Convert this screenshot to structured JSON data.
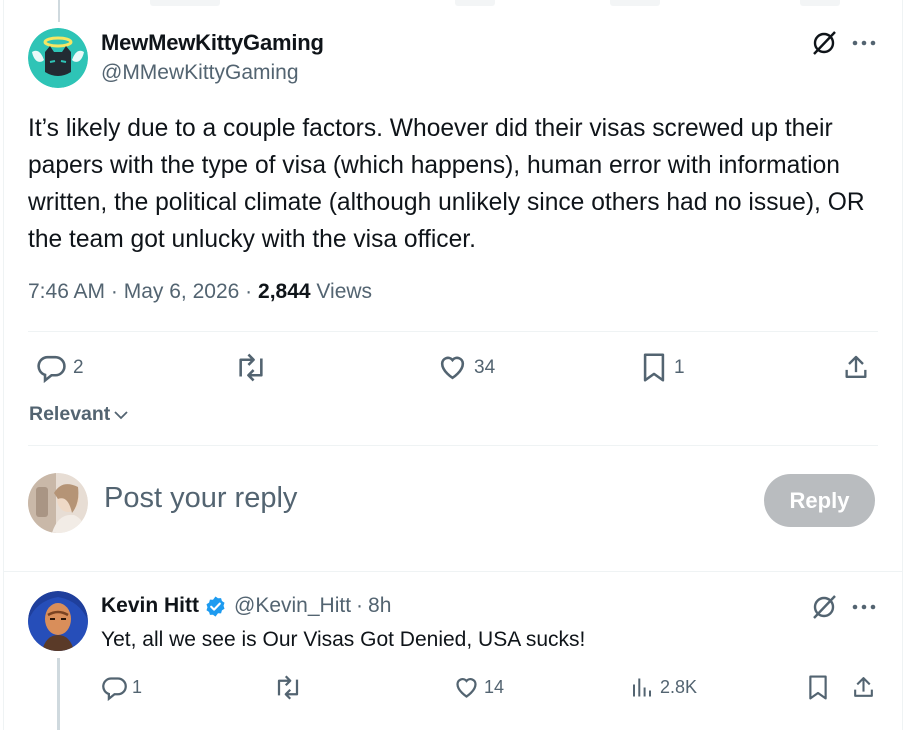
{
  "tweet": {
    "author_name": "MewMewKittyGaming",
    "author_handle": "@MMewKittyGaming",
    "text": "It’s likely due to a couple factors. Whoever did their visas screwed up their papers with the type of visa (which happens), human error with information written, the political climate (although unlikely since others had no issue), OR the team got unlucky with the visa officer.",
    "time": "7:46 AM",
    "separator": "·",
    "date": "May 6, 2026",
    "views_count": "2,844",
    "views_label": "Views",
    "actions": {
      "replies": "2",
      "reposts": "",
      "likes": "34",
      "bookmarks": "1"
    }
  },
  "sort": {
    "label": "Relevant"
  },
  "composer": {
    "placeholder": "Post your reply",
    "button_label": "Reply"
  },
  "reply": {
    "author_name": "Kevin Hitt",
    "author_handle": "@Kevin_Hitt",
    "separator": "·",
    "time_ago": "8h",
    "text": "Yet, all we see is Our Visas Got Denied, USA sucks!",
    "actions": {
      "replies": "1",
      "reposts": "",
      "likes": "14",
      "views": "2.8K"
    }
  },
  "colors": {
    "text_primary": "#0f1419",
    "text_secondary": "#536471",
    "verified_blue": "#1d9bf0",
    "reply_button_disabled": "#b9bcbf",
    "divider": "#eff3f4"
  },
  "icons": [
    "grok-icon",
    "more-icon",
    "reply-icon",
    "repost-icon",
    "like-icon",
    "bookmark-icon",
    "share-icon",
    "chevron-down-icon",
    "verified-badge-icon",
    "views-icon"
  ]
}
